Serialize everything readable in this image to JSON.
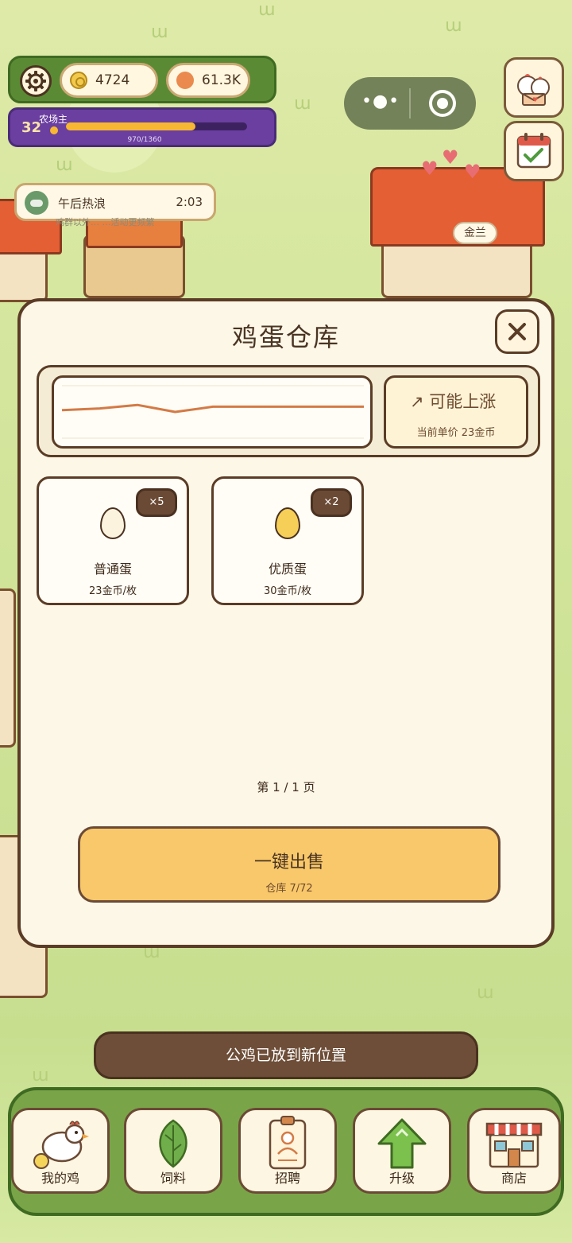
{
  "hud": {
    "gold": "4724",
    "gems": "61.3K",
    "level": "32",
    "level_title": "农场主",
    "xp_text": "970/1360",
    "xp_fraction": 0.713
  },
  "event": {
    "name": "午后热浪",
    "time": "2:03",
    "description": "鸡群以外…  …活动更频繁"
  },
  "farm": {
    "building_tag": "金兰"
  },
  "modal": {
    "title": "鸡蛋仓库",
    "trend": {
      "label": "↗ 可能上涨",
      "price_text": "当前单价 23金币"
    },
    "eggs": [
      {
        "name": "普通蛋",
        "price": "23金币/枚",
        "count": "×5",
        "color": "#fbf3de"
      },
      {
        "name": "优质蛋",
        "price": "30金币/枚",
        "count": "×2",
        "color": "#f5cf58"
      }
    ],
    "page": "第 1 / 1 页",
    "sell_button": "一键出售",
    "storage": "仓库 7/72"
  },
  "chart_data": {
    "type": "line",
    "values": [
      23,
      23.5,
      24.5,
      22.5,
      24,
      24,
      24,
      24,
      24
    ],
    "ylim": [
      15,
      30
    ]
  },
  "toast": "公鸡已放到新位置",
  "nav": [
    {
      "label": "我的鸡",
      "icon": "chicken-icon"
    },
    {
      "label": "饲料",
      "icon": "leaf-icon"
    },
    {
      "label": "招聘",
      "icon": "badge-icon"
    },
    {
      "label": "升级",
      "icon": "arrow-up-icon"
    },
    {
      "label": "商店",
      "icon": "shop-icon"
    }
  ]
}
